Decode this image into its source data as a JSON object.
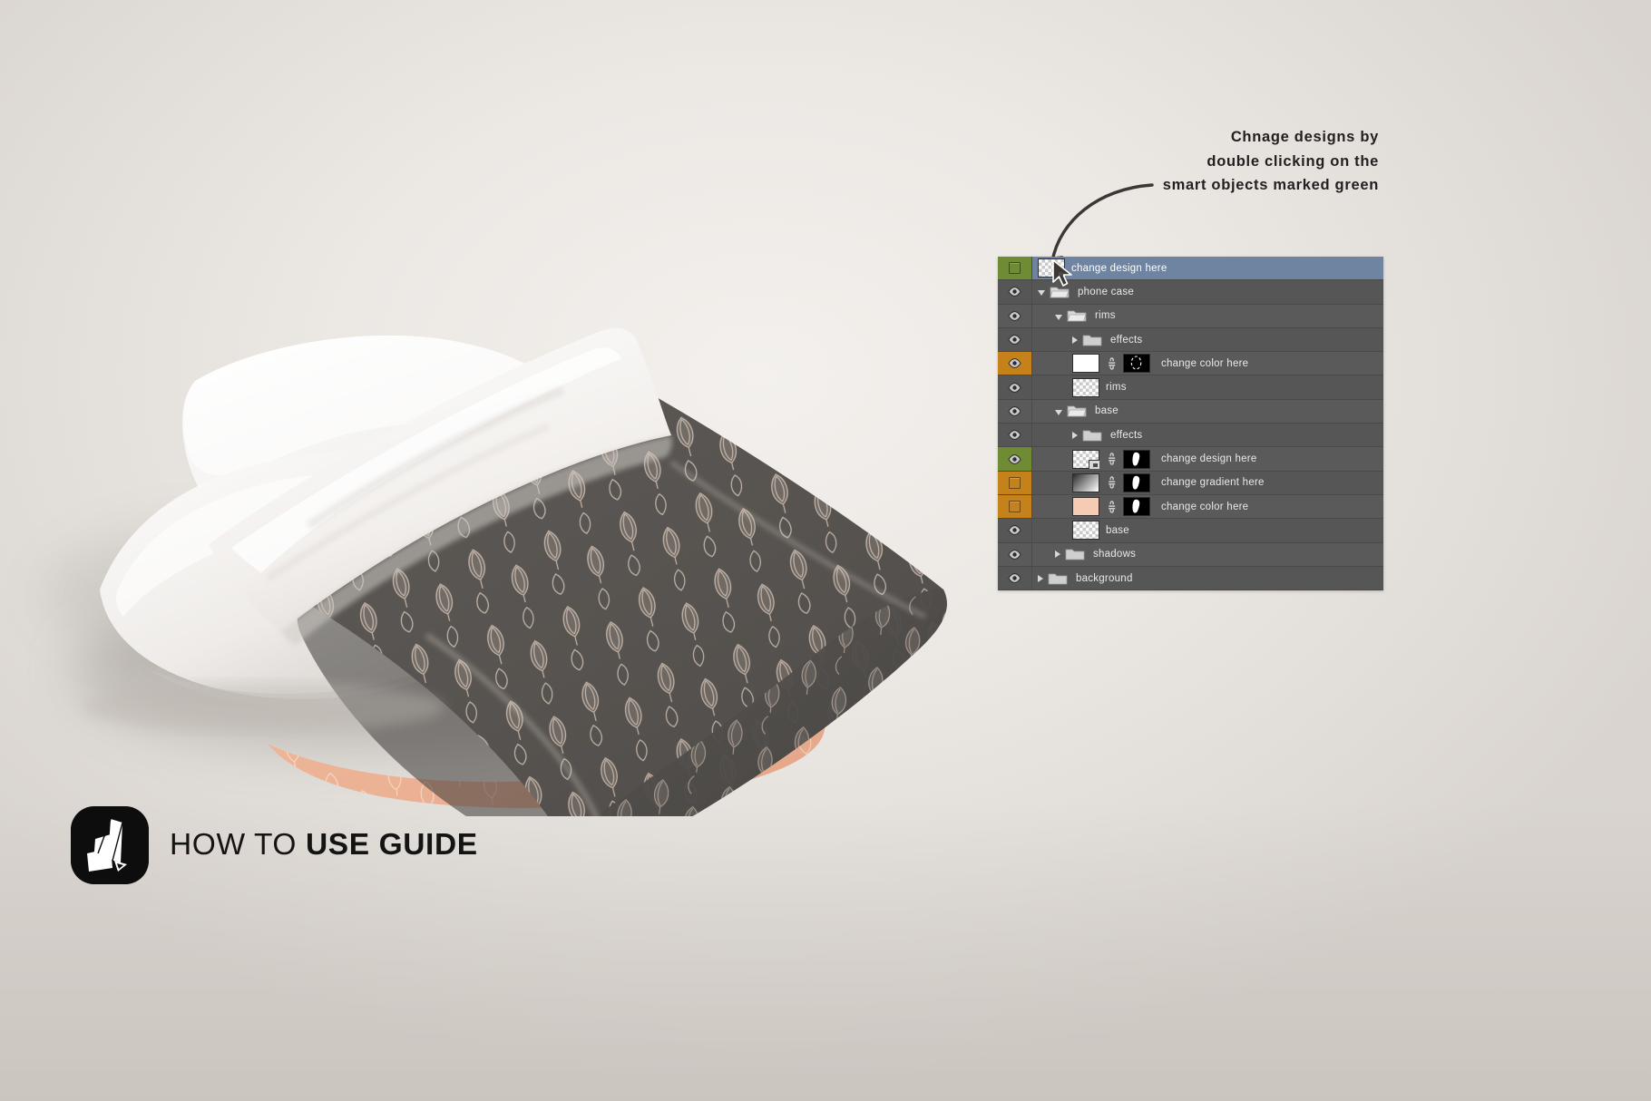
{
  "callout": {
    "line1": "Chnage designs by",
    "line2": "double clicking  on the",
    "line3": "smart objects marked green"
  },
  "footer": {
    "light_text": "HOW TO ",
    "bold_text": "USE GUIDE",
    "logo_icon": "mockup-logo-icon"
  },
  "colors": {
    "background": "#e2ded9",
    "panel_row": "#5a5a5a",
    "panel_row_selected": "#6f84a0",
    "marker_green": "#6f8b33",
    "marker_orange": "#c5811a",
    "text": "#e9e9e9",
    "swatch_peach": "#f6cbb4",
    "pattern_dark": "#565452"
  },
  "layers_panel": {
    "name": "photoshop-layers-panel",
    "rows": [
      {
        "label": "change design here",
        "marker": "green",
        "visible": false,
        "selected": true,
        "type": "smart-object",
        "indent": 0,
        "thumb": "checker-smart",
        "has_link": false,
        "has_mask": false,
        "folder": null
      },
      {
        "label": "phone case",
        "marker": "none",
        "visible": true,
        "selected": false,
        "type": "group",
        "indent": 0,
        "thumb": null,
        "has_link": false,
        "has_mask": false,
        "folder": "open"
      },
      {
        "label": "rims",
        "marker": "none",
        "visible": true,
        "selected": false,
        "type": "group",
        "indent": 1,
        "thumb": null,
        "has_link": false,
        "has_mask": false,
        "folder": "open"
      },
      {
        "label": "effects",
        "marker": "none",
        "visible": true,
        "selected": false,
        "type": "group",
        "indent": 2,
        "thumb": null,
        "has_link": false,
        "has_mask": false,
        "folder": "closed"
      },
      {
        "label": "change color here",
        "marker": "orange",
        "visible": true,
        "selected": false,
        "type": "fill-layer",
        "indent": 2,
        "thumb": "white",
        "has_link": true,
        "has_mask": true,
        "mask_shape": "ring",
        "folder": null
      },
      {
        "label": "rims",
        "marker": "none",
        "visible": true,
        "selected": false,
        "type": "pixel-layer",
        "indent": 2,
        "thumb": "checker",
        "has_link": false,
        "has_mask": false,
        "folder": null
      },
      {
        "label": "base",
        "marker": "none",
        "visible": true,
        "selected": false,
        "type": "group",
        "indent": 1,
        "thumb": null,
        "has_link": false,
        "has_mask": false,
        "folder": "open"
      },
      {
        "label": "effects",
        "marker": "none",
        "visible": true,
        "selected": false,
        "type": "group",
        "indent": 2,
        "thumb": null,
        "has_link": false,
        "has_mask": false,
        "folder": "closed"
      },
      {
        "label": "change design here",
        "marker": "green",
        "visible": true,
        "selected": false,
        "type": "smart-object",
        "indent": 2,
        "thumb": "checker-smart",
        "has_link": true,
        "has_mask": true,
        "mask_shape": "blob",
        "folder": null
      },
      {
        "label": "change gradient here",
        "marker": "orange",
        "visible": false,
        "selected": false,
        "type": "gradient-layer",
        "indent": 2,
        "thumb": "gradient",
        "has_link": true,
        "has_mask": true,
        "mask_shape": "blob",
        "folder": null
      },
      {
        "label": "change color here",
        "marker": "orange",
        "visible": false,
        "selected": false,
        "type": "fill-layer",
        "indent": 2,
        "thumb": "peach",
        "has_link": true,
        "has_mask": true,
        "mask_shape": "blob",
        "folder": null
      },
      {
        "label": "base",
        "marker": "none",
        "visible": true,
        "selected": false,
        "type": "pixel-layer",
        "indent": 2,
        "thumb": "checker",
        "has_link": false,
        "has_mask": false,
        "folder": null
      },
      {
        "label": "shadows",
        "marker": "none",
        "visible": true,
        "selected": false,
        "type": "group",
        "indent": 1,
        "thumb": null,
        "has_link": false,
        "has_mask": false,
        "folder": "closed"
      },
      {
        "label": "background",
        "marker": "none",
        "visible": true,
        "selected": false,
        "type": "group",
        "indent": 0,
        "thumb": null,
        "has_link": false,
        "has_mask": false,
        "folder": "closed"
      }
    ]
  },
  "scene": {
    "description": "pillow-mockup-photo",
    "items": [
      "white-pillow",
      "patterned-cushion"
    ]
  }
}
